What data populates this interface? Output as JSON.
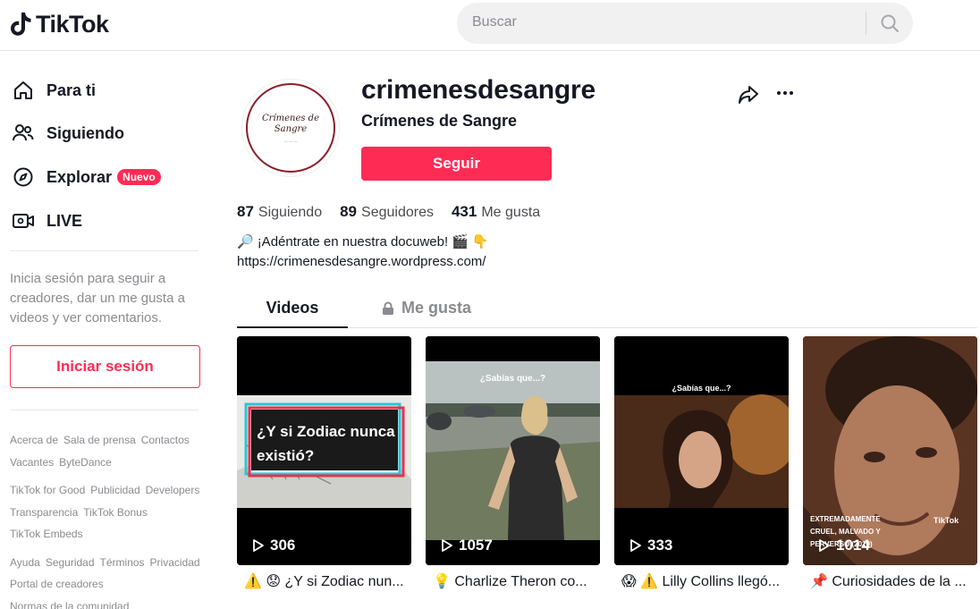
{
  "app": {
    "name": "TikTok",
    "brand_color": "#fe2c55"
  },
  "search": {
    "placeholder": "Buscar"
  },
  "sidebar": {
    "nav": [
      {
        "label": "Para ti",
        "icon": "home-icon"
      },
      {
        "label": "Siguiendo",
        "icon": "users-icon"
      },
      {
        "label": "Explorar",
        "icon": "compass-icon",
        "badge": "Nuevo"
      },
      {
        "label": "LIVE",
        "icon": "live-icon"
      }
    ],
    "login_prompt": "Inicia sesión para seguir a creadores, dar un me gusta a videos y ver comentarios.",
    "login_button": "Iniciar sesión",
    "footer_groups": [
      [
        "Acerca de",
        "Sala de prensa",
        "Contactos",
        "Vacantes",
        "ByteDance"
      ],
      [
        "TikTok for Good",
        "Publicidad",
        "Developers",
        "Transparencia",
        "TikTok Bonus",
        "TikTok Embeds"
      ],
      [
        "Ayuda",
        "Seguridad",
        "Términos",
        "Privacidad",
        "Portal de creadores",
        "Normas de la comunidad"
      ]
    ]
  },
  "profile": {
    "username": "crimenesdesangre",
    "nickname": "Crímenes de Sangre",
    "avatar_text": "Crímenes de Sangre",
    "follow_button": "Seguir",
    "stats": {
      "following_count": "87",
      "following_label": "Siguiendo",
      "followers_count": "89",
      "followers_label": "Seguidores",
      "likes_count": "431",
      "likes_label": "Me gusta"
    },
    "bio_line1": "¡Adéntrate en nuestra docuweb!",
    "bio_line2": "https://crimenesdesangre.wordpress.com/"
  },
  "tabs": {
    "videos": "Videos",
    "likes": "Me gusta"
  },
  "videos": [
    {
      "views": "306",
      "caption": "⚠️ 😟 ¿Y si Zodiac nun...",
      "overlay": "¿Y si Zodiac nunca existió?"
    },
    {
      "views": "1057",
      "caption": "💡 Charlize Theron co...",
      "overlay": "¿Sabías que...?"
    },
    {
      "views": "333",
      "caption": "😱 ⚠️ Lilly Collins llegó...",
      "overlay": "¿Sabías que...?"
    },
    {
      "views": "1014",
      "caption": "📌 Curiosidades de la ...",
      "overlay": "EXTREMADAMENTE CRUEL, MALVADO Y PERVERSO (2019)",
      "watermark": "TikTok"
    }
  ]
}
